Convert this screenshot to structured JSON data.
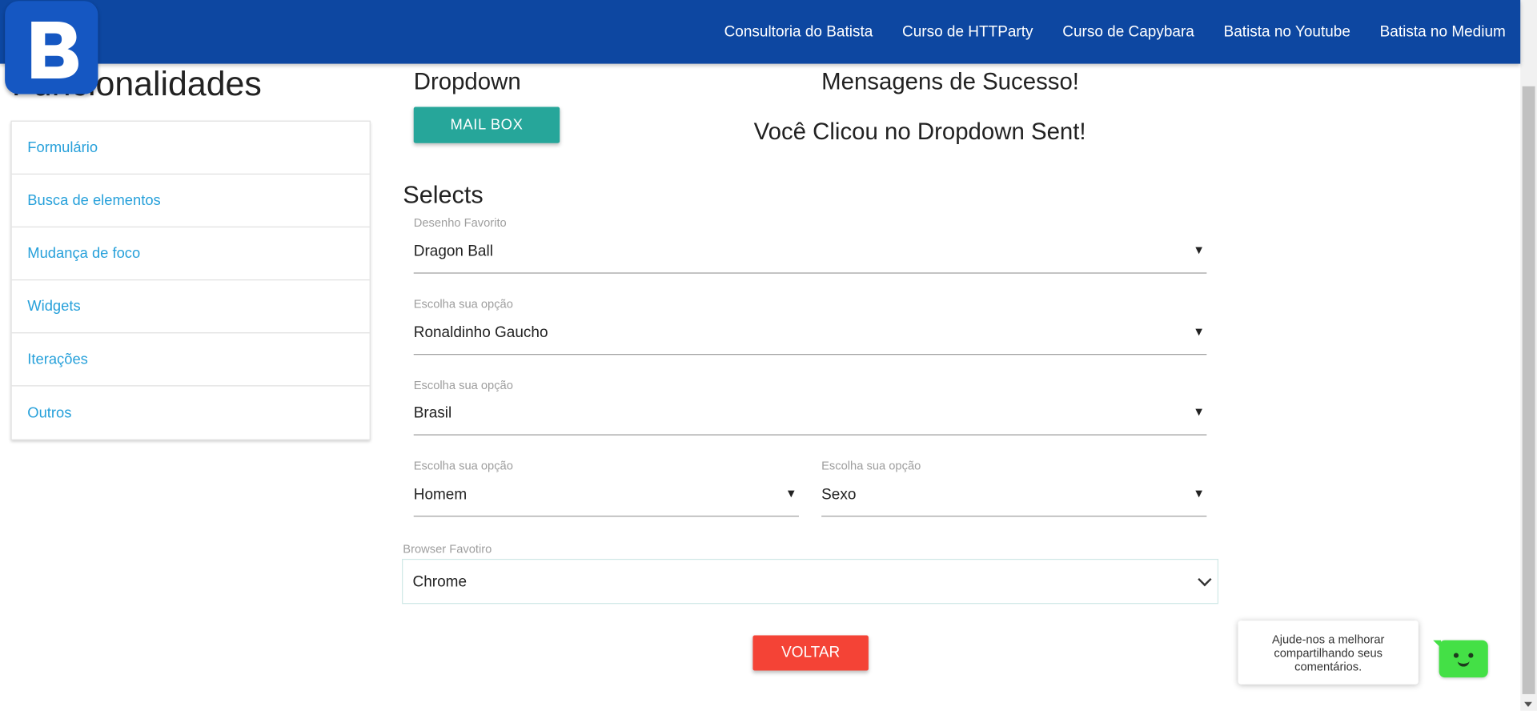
{
  "nav": {
    "links": [
      "Consultoria do Batista",
      "Curso de HTTParty",
      "Curso de Capybara",
      "Batista no Youtube",
      "Batista no Medium"
    ],
    "logo_letter": "B",
    "bar_color": "#0d47a1"
  },
  "page_title": "Funcionalidades",
  "sidebar": {
    "items": [
      "Formulário",
      "Busca de elementos",
      "Mudança de foco",
      "Widgets",
      "Iterações",
      "Outros"
    ]
  },
  "dropdown": {
    "heading": "Dropdown",
    "button_label": "MAIL BOX"
  },
  "success": {
    "title": "Mensagens de Sucesso!",
    "message": "Você Clicou no Dropdown Sent!"
  },
  "selects": {
    "heading": "Selects",
    "fields": [
      {
        "label": "Desenho Favorito",
        "value": "Dragon Ball"
      },
      {
        "label": "Escolha sua opção",
        "value": "Ronaldinho Gaucho"
      },
      {
        "label": "Escolha sua opção",
        "value": "Brasil"
      },
      {
        "label": "Escolha sua opção",
        "value": "Homem"
      },
      {
        "label": "Escolha sua opção",
        "value": "Sexo"
      }
    ],
    "browser": {
      "label": "Browser Favotiro",
      "value": "Chrome"
    }
  },
  "back_button": "VOLTAR",
  "feedback": {
    "text": "Ajude-nos a melhorar compartilhando seus comentários."
  },
  "colors": {
    "teal_button": "#26a69a",
    "red_button": "#f44336",
    "link_blue": "#26a0da",
    "bot_green": "#44e046"
  }
}
